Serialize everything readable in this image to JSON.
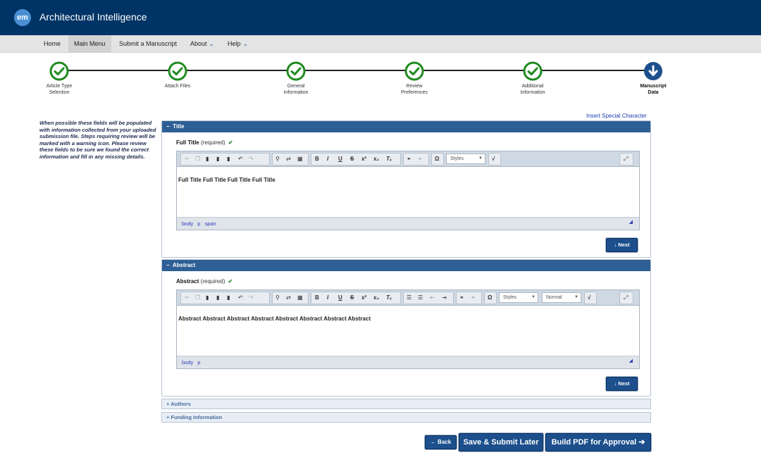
{
  "header": {
    "logo": "em",
    "app_title": "Architectural Intelligence"
  },
  "nav": {
    "items": [
      {
        "label": "Home"
      },
      {
        "label": "Main Menu"
      },
      {
        "label": "Submit a Manuscript"
      },
      {
        "label": "About"
      },
      {
        "label": "Help"
      }
    ]
  },
  "steps": [
    {
      "l1": "Article Type",
      "l2": "Selection",
      "status": "done"
    },
    {
      "l1": "Attach Files",
      "l2": "",
      "status": "done"
    },
    {
      "l1": "General",
      "l2": "Information",
      "status": "done"
    },
    {
      "l1": "Review",
      "l2": "Preferences",
      "status": "done"
    },
    {
      "l1": "Additional",
      "l2": "Information",
      "status": "done"
    },
    {
      "l1": "Manuscript",
      "l2": "Data",
      "status": "current"
    }
  ],
  "side_note": "When possible these fields will be populated with information collected from your uploaded submission file. Steps requiring review will be marked with a warning icon. Please review these fields to be sure we found the correct information and fill in any missing details.",
  "insert_special_character": "Insert Special Character",
  "title_panel": {
    "header": "Title",
    "field_label": "Full Title",
    "required": "(required)",
    "styles_label": "Styles",
    "content": "Full Title Full Title Full Title Full Title",
    "path": [
      "body",
      "p",
      "span"
    ],
    "next_label": "Next"
  },
  "abstract_panel": {
    "header": "Abstract",
    "field_label": "Abstract",
    "required": "(required)",
    "styles_label": "Styles",
    "format_label": "Normal",
    "content": "Abstract Abstract Abstract Abstract Abstract Abstract Abstract Abstract",
    "path": [
      "body",
      "p"
    ],
    "next_label": "Next"
  },
  "collapsed_sections": [
    {
      "label": "Authors"
    },
    {
      "label": "Funding Information"
    }
  ],
  "buttons": {
    "back": "Back",
    "save_later": "Save & Submit Later",
    "build_pdf": "Build PDF for Approval"
  },
  "colors": {
    "header_bg": "#003466",
    "panel_header": "#2e5f94",
    "check_green": "#1f8a1f",
    "button_blue": "#1c4f8c"
  }
}
